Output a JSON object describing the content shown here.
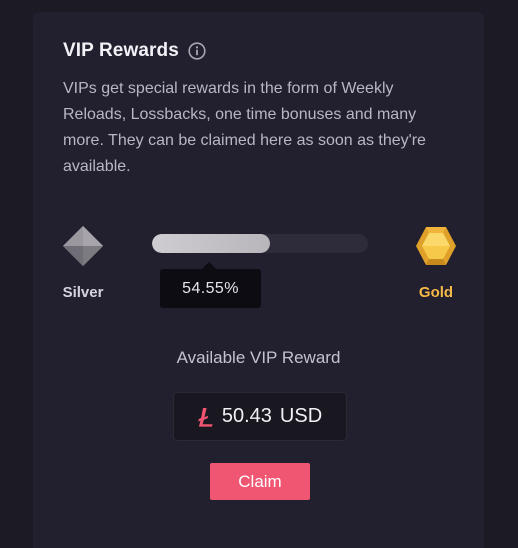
{
  "vip_rewards": {
    "title": "VIP Rewards",
    "info_icon": "info-circle-icon",
    "description": "VIPs get special rewards in the form of Weekly Reloads, Lossbacks, one time bonuses and many more. They can be claimed here as soon as they're available."
  },
  "progress": {
    "current_tier": "Silver",
    "current_tier_icon": "silver-diamond-icon",
    "next_tier": "Gold",
    "next_tier_icon": "gold-hexagon-icon",
    "percent_value": 54.55,
    "percent_label": "54.55%"
  },
  "reward": {
    "label": "Available VIP Reward",
    "currency_icon": "litecoin-icon",
    "amount": "50.43",
    "currency": "USD"
  },
  "actions": {
    "claim_label": "Claim"
  },
  "colors": {
    "background": "#1c1a24",
    "card": "#221f2e",
    "accent": "#f05672",
    "gold": "#f5b947",
    "silver": "#d6d4dd"
  }
}
